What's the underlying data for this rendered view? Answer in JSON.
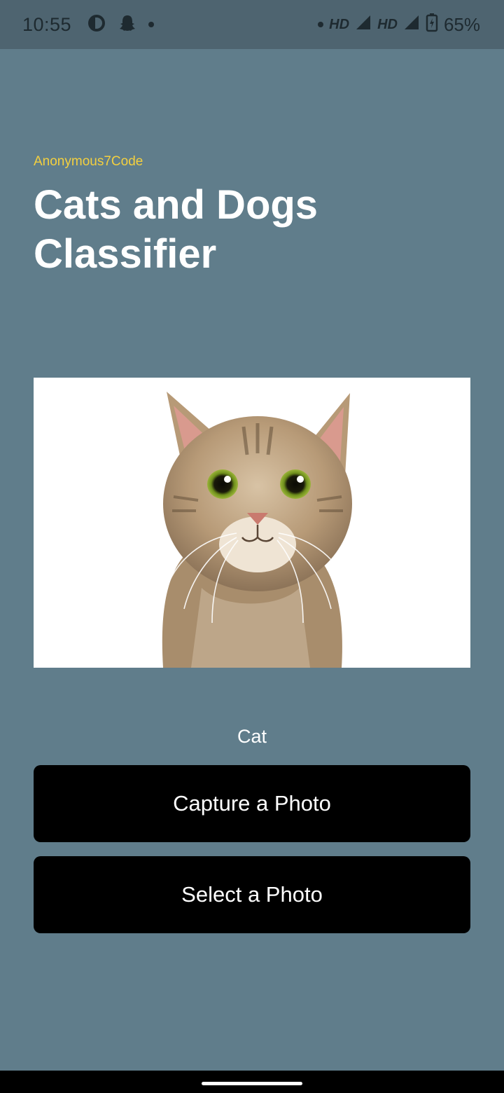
{
  "status_bar": {
    "time": "10:55",
    "hd1": "HD",
    "hd2": "HD",
    "battery": "65%"
  },
  "app": {
    "author": "Anonymous7Code",
    "title": "Cats and Dogs Classifier",
    "prediction": "Cat"
  },
  "buttons": {
    "capture_label": "Capture a Photo",
    "select_label": "Select a Photo"
  },
  "colors": {
    "background": "#607d8b",
    "status_bar": "#4e6470",
    "accent_text": "#f4d03f",
    "button": "#000000"
  },
  "icons": [
    "pie-chart-icon",
    "snapchat-ghost-icon",
    "notification-dot-icon",
    "signal-icon",
    "battery-charging-icon"
  ]
}
